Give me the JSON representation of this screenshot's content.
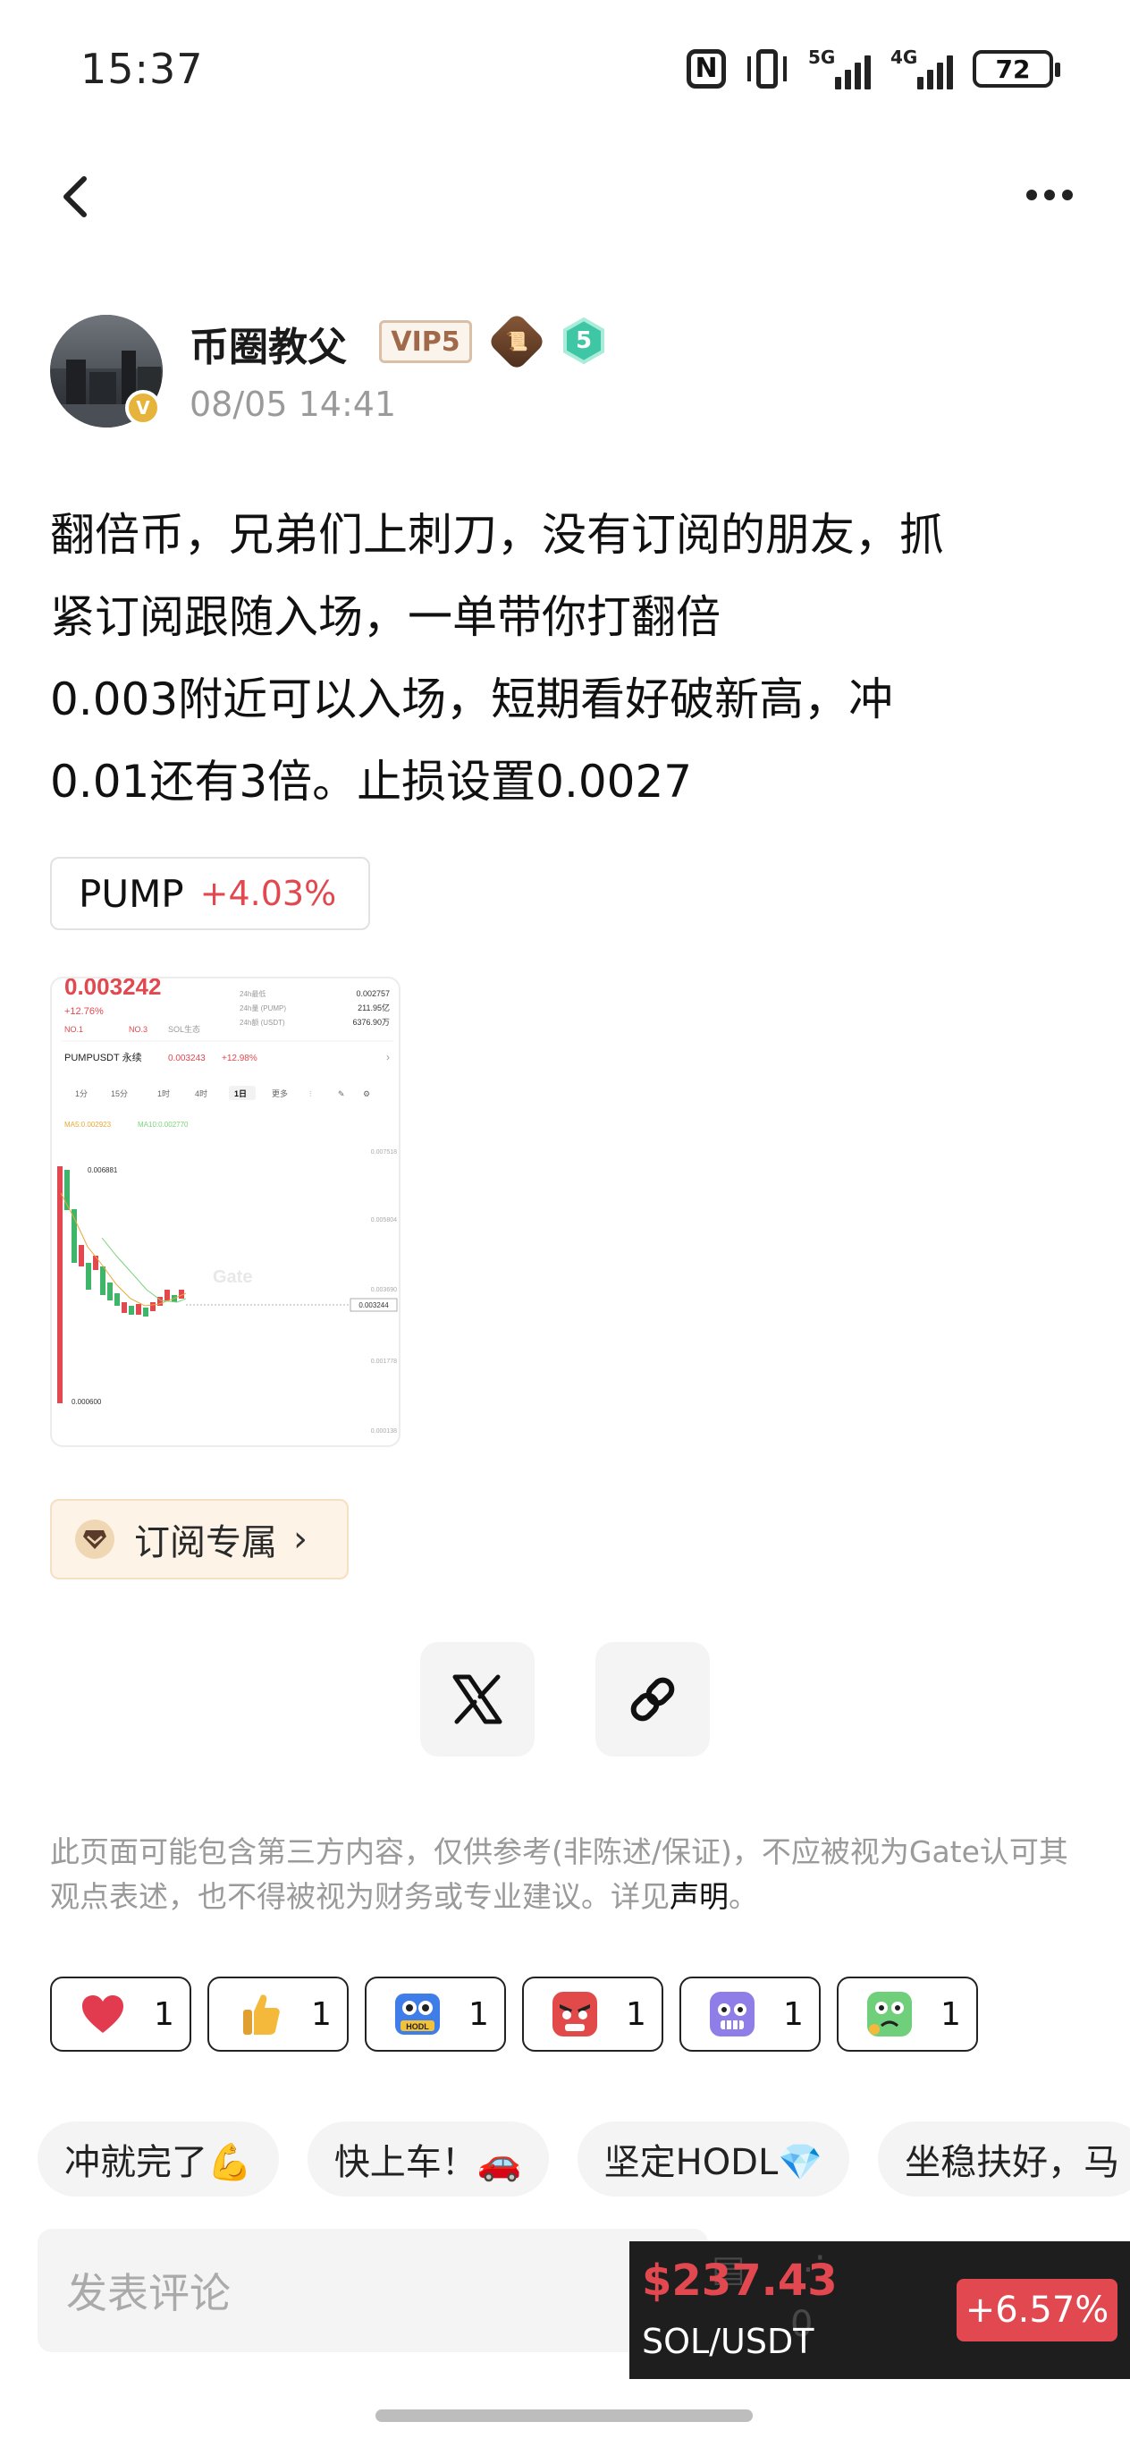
{
  "status_bar": {
    "time": "15:37",
    "network_1": "5G",
    "network_2": "4G",
    "battery": "72"
  },
  "author": {
    "name": "币圈教父",
    "vip": "VIP5",
    "level": "5",
    "avatar_badge": "V",
    "time": "08/05 14:41"
  },
  "post": {
    "lines": [
      "翻倍币，兄弟们上刺刀，没有订阅的朋友，抓",
      "紧订阅跟随入场，一单带你打翻倍",
      "0.003附近可以入场，短期看好破新高，冲",
      "0.01还有3倍。止损设置0.0027"
    ]
  },
  "ticker": {
    "symbol": "PUMP",
    "change": "+4.03%"
  },
  "chart_thumb": {
    "price": "0.003242",
    "change": "+12.76%",
    "tag_1": "NO.1",
    "tag_2": "NO.3",
    "tag_3": "SOL生态",
    "stat_1_label": "24h最低",
    "stat_1_value": "0.002757",
    "stat_2_label": "24h量 (PUMP)",
    "stat_2_value": "211.95亿",
    "stat_3_label": "24h额 (USDT)",
    "stat_3_value": "6376.90万",
    "pair": "PUMPUSDT 永续",
    "pair_price": "0.003243",
    "pair_change": "+12.98%",
    "intervals": [
      "1分",
      "15分",
      "1时",
      "4时",
      "1日",
      "更多"
    ],
    "ma1": "MA5:0.002923",
    "ma2": "MA10:0.002770",
    "high_label": "0.006881",
    "low_label": "0.000600",
    "axis": [
      "0.007518",
      "0.005804",
      "0.003690",
      "0.003244",
      "0.001778",
      "0.000138"
    ],
    "watermark": "Gate"
  },
  "subscribe": {
    "label": "订阅专属",
    "chevron": "›"
  },
  "disclaimer": {
    "text": "此页面可能包含第三方内容，仅供参考(非陈述/保证)，不应被视为Gate认可其观点表述，也不得被视为财务或专业建议。详见",
    "link": "声明",
    "end": "。"
  },
  "reactions": [
    {
      "icon": "heart-icon",
      "count": "1"
    },
    {
      "icon": "thumbs-up-icon",
      "count": "1"
    },
    {
      "icon": "hodl-robot-icon",
      "count": "1"
    },
    {
      "icon": "angry-face-icon",
      "count": "1"
    },
    {
      "icon": "purple-face-icon",
      "count": "1"
    },
    {
      "icon": "sick-face-icon",
      "count": "1"
    }
  ],
  "quick_replies": [
    "冲就完了💪",
    "快上车！🚗",
    "坚定HODL💎",
    "坐稳扶好，马"
  ],
  "comment": {
    "placeholder": "发表评论"
  },
  "price_widget": {
    "price": "$237.43",
    "pair": "SOL/USDT",
    "change": "+6.57%",
    "hidden_count": "0"
  },
  "colors": {
    "red": "#e2484f",
    "vip_text": "#a0694a",
    "level_green": "#3fc7a5"
  }
}
